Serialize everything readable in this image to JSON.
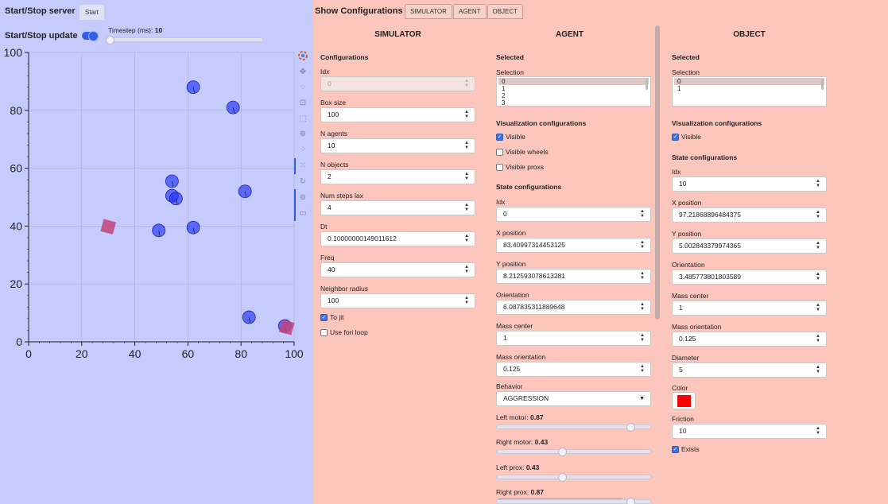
{
  "left": {
    "server_label": "Start/Stop server",
    "start_button": "Start",
    "update_label": "Start/Stop update",
    "timestep_label": "Timestep (ms):",
    "timestep_value": "10"
  },
  "chart_data": {
    "type": "scatter",
    "xlim": [
      0,
      100
    ],
    "ylim": [
      0,
      100
    ],
    "x_ticks": [
      "0",
      "20",
      "40",
      "60",
      "80",
      "100"
    ],
    "y_ticks": [
      "0",
      "20",
      "40",
      "60",
      "80",
      "100"
    ],
    "grid": true,
    "series": [
      {
        "marker": "circle",
        "color": "#2233ff",
        "points": [
          [
            62,
            88
          ],
          [
            77,
            81
          ],
          [
            54,
            55.5
          ],
          [
            54,
            50.5
          ],
          [
            55.5,
            49.5
          ],
          [
            81.5,
            52
          ],
          [
            49,
            38.5
          ],
          [
            62,
            39.5
          ],
          [
            83,
            8.5
          ],
          [
            96.5,
            5.5
          ]
        ]
      },
      {
        "marker": "square",
        "color": "#c2457a",
        "points": [
          [
            30,
            39.8
          ],
          [
            97.2,
            5
          ]
        ]
      }
    ]
  },
  "toolbar_icons": [
    "bokeh-logo-icon",
    "pan-icon",
    "lasso-icon",
    "box-zoom-icon",
    "box-select-icon",
    "wheel-zoom-icon",
    "tap-icon",
    "point-draw-icon",
    "reset-icon",
    "hover-icon",
    "help-icon"
  ],
  "right": {
    "show_label": "Show Configurations",
    "tabs": [
      "SIMULATOR",
      "AGENT",
      "OBJECT"
    ],
    "simulator": {
      "title": "SIMULATOR",
      "section": "Configurations",
      "fields": [
        {
          "label": "Idx",
          "value": "0",
          "disabled": true
        },
        {
          "label": "Box size",
          "value": "100"
        },
        {
          "label": "N agents",
          "value": "10"
        },
        {
          "label": "N objects",
          "value": "2"
        },
        {
          "label": "Num steps lax",
          "value": "4"
        },
        {
          "label": "Dt",
          "value": "0.10000000149011612"
        },
        {
          "label": "Freq",
          "value": "40"
        },
        {
          "label": "Neighbor radius",
          "value": "100"
        }
      ],
      "checks": [
        {
          "label": "To jit",
          "checked": true
        },
        {
          "label": "Use fori loop",
          "checked": false
        }
      ]
    },
    "agent": {
      "title": "AGENT",
      "selected_header": "Selected",
      "selection_label": "Selection",
      "selection_items": [
        "0",
        "1",
        "2",
        "3"
      ],
      "vis_header": "Visualization configurations",
      "vis_checks": [
        {
          "label": "Visible",
          "checked": true
        },
        {
          "label": "Visible wheels",
          "checked": false
        },
        {
          "label": "Visible proxs",
          "checked": false
        }
      ],
      "state_header": "State configurations",
      "fields": [
        {
          "label": "Idx",
          "value": "0"
        },
        {
          "label": "X position",
          "value": "83.40997314453125"
        },
        {
          "label": "Y position",
          "value": "8.212593078613281"
        },
        {
          "label": "Orientation",
          "value": "6.087835311889648"
        },
        {
          "label": "Mass center",
          "value": "1"
        },
        {
          "label": "Mass orientation",
          "value": "0.125"
        }
      ],
      "behavior_label": "Behavior",
      "behavior_value": "AGGRESSION",
      "sliders": [
        {
          "label": "Left motor:",
          "value": "0.87",
          "fraction": 0.87
        },
        {
          "label": "Right motor:",
          "value": "0.43",
          "fraction": 0.43
        },
        {
          "label": "Left prox:",
          "value": "0.43",
          "fraction": 0.43
        },
        {
          "label": "Right prox:",
          "value": "0.87",
          "fraction": 0.87
        }
      ]
    },
    "object": {
      "title": "OBJECT",
      "selected_header": "Selected",
      "selection_label": "Selection",
      "selection_items": [
        "0",
        "1"
      ],
      "vis_header": "Visualization configurations",
      "vis_checks": [
        {
          "label": "Visible",
          "checked": true
        }
      ],
      "state_header": "State configurations",
      "fields": [
        {
          "label": "Idx",
          "value": "10"
        },
        {
          "label": "X position",
          "value": "97.21868896484375"
        },
        {
          "label": "Y position",
          "value": "5.002843379974365"
        },
        {
          "label": "Orientation",
          "value": "3.485773801803589"
        },
        {
          "label": "Mass center",
          "value": "1"
        },
        {
          "label": "Mass orientation",
          "value": "0.125"
        },
        {
          "label": "Diameter",
          "value": "5"
        }
      ],
      "color_label": "Color",
      "color_value": "#ff0000",
      "friction_label": "Friction",
      "friction_value": "10",
      "exists_label": "Exists",
      "exists_checked": true
    }
  }
}
